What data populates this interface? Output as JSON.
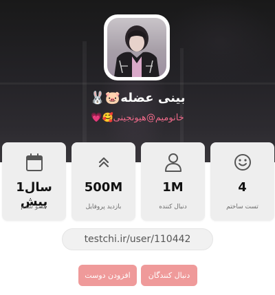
{
  "profile": {
    "display_name": "بینی عضله🐷🐰",
    "username": "خانومیم@هیونجینی🥰💗"
  },
  "stats": [
    {
      "icon": "smile-icon",
      "value": "4",
      "label": "تست ساختم"
    },
    {
      "icon": "user-icon",
      "value": "1M",
      "label": "دنبال کننده"
    },
    {
      "icon": "double-chevron-up-icon",
      "value": "500M",
      "label": "بازدید پروفایل"
    },
    {
      "icon": "calendar-icon",
      "value": "1سال پیش",
      "label": "عضو شدم"
    }
  ],
  "profile_link": "testchi.ir/user/110442",
  "buttons": {
    "followers": "دنبال کنندگان",
    "add_friend": "افزودن دوست"
  },
  "colors": {
    "accent_button": "#ef9a9a",
    "username_pink": "#f06a8a",
    "card_background": "#eeeeee"
  }
}
